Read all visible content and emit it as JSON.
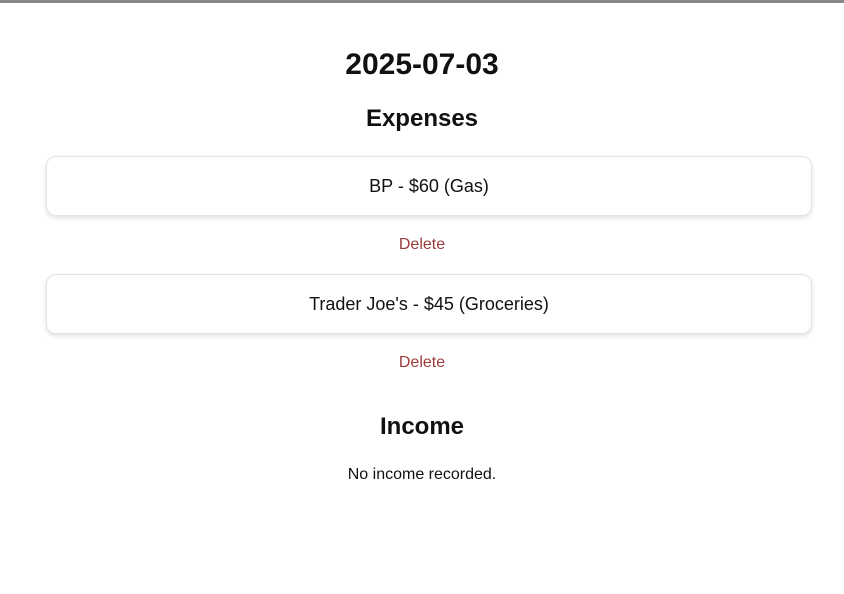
{
  "date": "2025-07-03",
  "expenses": {
    "heading": "Expenses",
    "items": [
      {
        "label": "BP - $60 (Gas)",
        "delete_label": "Delete"
      },
      {
        "label": "Trader Joe's - $45 (Groceries)",
        "delete_label": "Delete"
      }
    ]
  },
  "income": {
    "heading": "Income",
    "empty_message": "No income recorded."
  },
  "colors": {
    "delete": "#9b3b3b",
    "text": "#111111"
  }
}
